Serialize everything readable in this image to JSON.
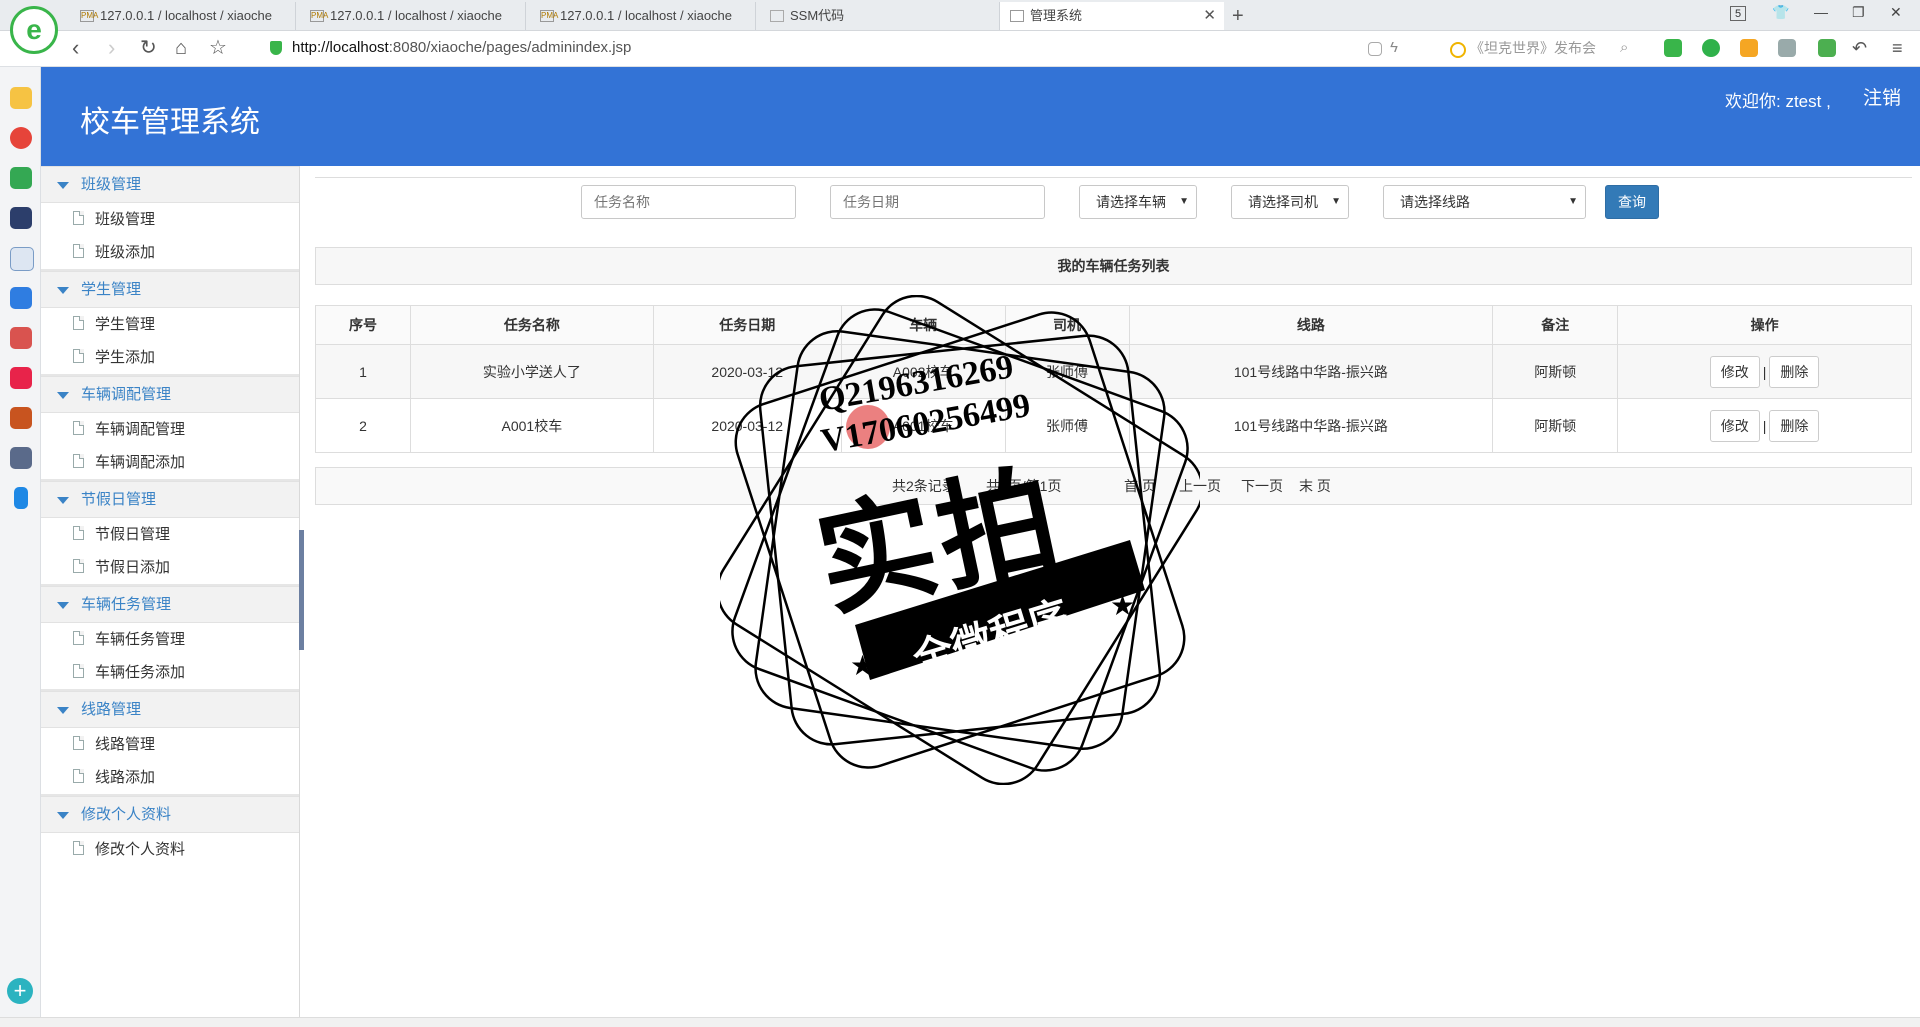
{
  "browser": {
    "tabs": [
      {
        "title": "127.0.0.1 / localhost / xiaoche",
        "fav": "PMA"
      },
      {
        "title": "127.0.0.1 / localhost / xiaoche",
        "fav": "PMA"
      },
      {
        "title": "127.0.0.1 / localhost / xiaoche",
        "fav": "PMA"
      },
      {
        "title": "SSM代码",
        "fav": ""
      },
      {
        "title": "管理系统",
        "fav": ""
      }
    ],
    "tab_count": "5",
    "url_host": "http://localhost",
    "url_rest": ":8080/xiaoche/pages/adminindex.jsp",
    "search_text": "《坦克世界》发布会",
    "accent_color": "#3373d6"
  },
  "header": {
    "title": "校车管理系统",
    "welcome": "欢迎你: ztest ,",
    "logout": "注销"
  },
  "menu": [
    {
      "label": "班级管理",
      "items": [
        "班级管理",
        "班级添加"
      ]
    },
    {
      "label": "学生管理",
      "items": [
        "学生管理",
        "学生添加"
      ]
    },
    {
      "label": "车辆调配管理",
      "items": [
        "车辆调配管理",
        "车辆调配添加"
      ]
    },
    {
      "label": "节假日管理",
      "items": [
        "节假日管理",
        "节假日添加"
      ]
    },
    {
      "label": "车辆任务管理",
      "items": [
        "车辆任务管理",
        "车辆任务添加"
      ]
    },
    {
      "label": "线路管理",
      "items": [
        "线路管理",
        "线路添加"
      ]
    },
    {
      "label": "修改个人资料",
      "items": [
        "修改个人资料"
      ]
    }
  ],
  "filters": {
    "task_name_placeholder": "任务名称",
    "task_date_placeholder": "任务日期",
    "vehicle_select": "请选择车辆",
    "driver_select": "请选择司机",
    "route_select": "请选择线路",
    "query_label": "查询"
  },
  "list": {
    "title": "我的车辆任务列表",
    "columns": [
      "序号",
      "任务名称",
      "任务日期",
      "车辆",
      "司机",
      "线路",
      "备注",
      "操作"
    ],
    "rows": [
      {
        "no": "1",
        "name": "实验小学送人了",
        "date": "2020-03-12",
        "vehicle": "A002校车",
        "driver": "张师傅",
        "route": "101号线路中华路-振兴路",
        "note": "阿斯顿"
      },
      {
        "no": "2",
        "name": "A001校车",
        "date": "2020-03-12",
        "vehicle": "A001校车",
        "driver": "张师傅",
        "route": "101号线路中华路-振兴路",
        "note": "阿斯顿"
      }
    ],
    "edit_label": "修改",
    "delete_label": "删除",
    "separator": "|"
  },
  "pager": {
    "summary": "共2条记录",
    "pages": "共1页/第1页",
    "first": "首 页",
    "prev": "上一页",
    "next": "下一页",
    "last": "末 页"
  },
  "watermark": {
    "qq": "Q2196316269",
    "v": "V17060256499",
    "main": "实拍",
    "banner": "全微程序"
  }
}
